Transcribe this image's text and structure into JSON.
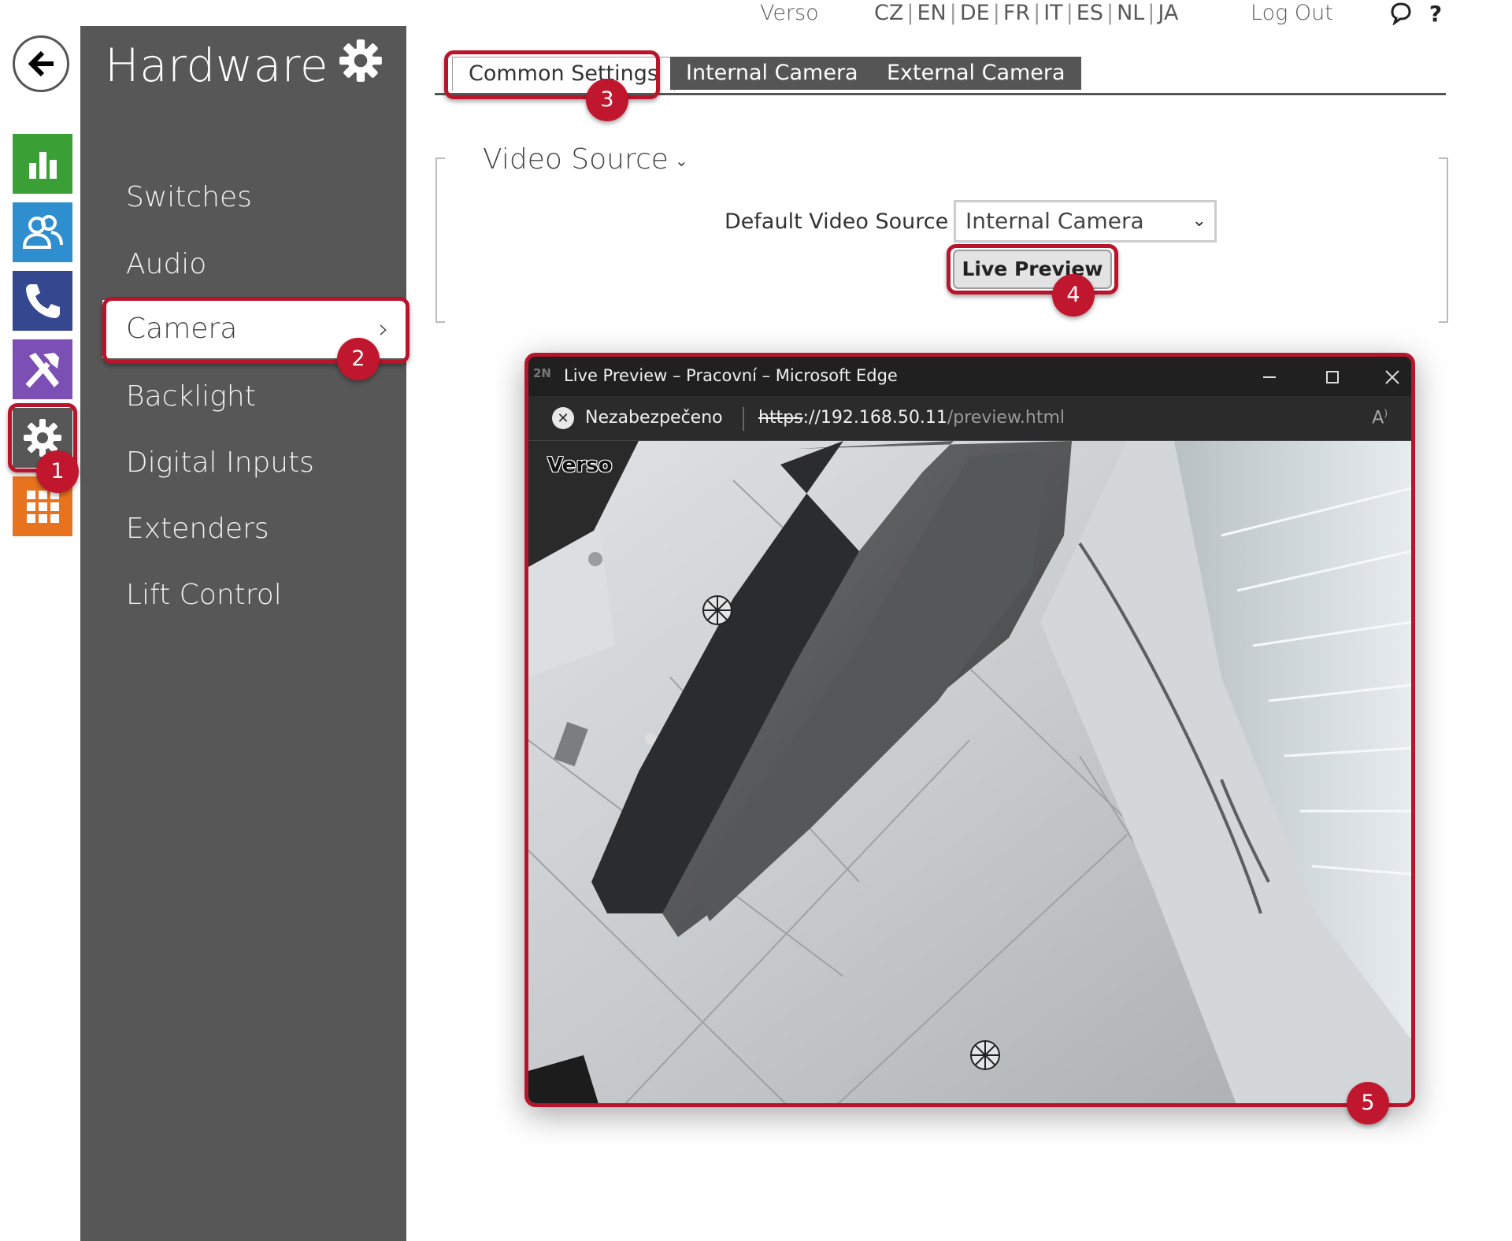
{
  "topbar": {
    "device_name": "Verso",
    "languages": [
      "CZ",
      "EN",
      "DE",
      "FR",
      "IT",
      "ES",
      "NL",
      "JA"
    ],
    "logout": "Log Out",
    "help": "?"
  },
  "rail": {
    "items": [
      {
        "name": "status",
        "icon": "bar-chart-icon",
        "color": "#3aa035"
      },
      {
        "name": "directory",
        "icon": "users-icon",
        "color": "#2f8fce"
      },
      {
        "name": "calls",
        "icon": "phone-icon",
        "color": "#34478f"
      },
      {
        "name": "services",
        "icon": "tools-icon",
        "color": "#7b4fb3"
      },
      {
        "name": "hardware",
        "icon": "gear-icon",
        "color": "#575757"
      },
      {
        "name": "system",
        "icon": "grid-icon",
        "color": "#e8731e"
      }
    ]
  },
  "sidebar": {
    "title": "Hardware",
    "items": [
      {
        "label": "Switches"
      },
      {
        "label": "Audio"
      },
      {
        "label": "Camera",
        "active": true
      },
      {
        "label": "Backlight"
      },
      {
        "label": "Digital Inputs"
      },
      {
        "label": "Extenders"
      },
      {
        "label": "Lift Control"
      }
    ]
  },
  "tabs": [
    {
      "label": "Common Settings",
      "active": true
    },
    {
      "label": "Internal Camera",
      "active": false
    },
    {
      "label": "External Camera",
      "active": false
    }
  ],
  "video_source": {
    "title": "Video Source",
    "default_label": "Default Video Source",
    "default_value": "Internal Camera",
    "live_preview": "Live Preview"
  },
  "badges": [
    "1",
    "2",
    "3",
    "4",
    "5"
  ],
  "browser": {
    "title": "Live Preview – Pracovní – Microsoft Edge",
    "logo": "2N",
    "security": "Nezabezpečeno",
    "url_scheme": "https",
    "url_host": "://192.168.50.11",
    "url_path": "/preview.html",
    "camera_overlay": "Verso"
  },
  "colors": {
    "accent_red": "#b8142c",
    "sidebar_bg": "#575757",
    "tab_inactive": "#555555"
  }
}
